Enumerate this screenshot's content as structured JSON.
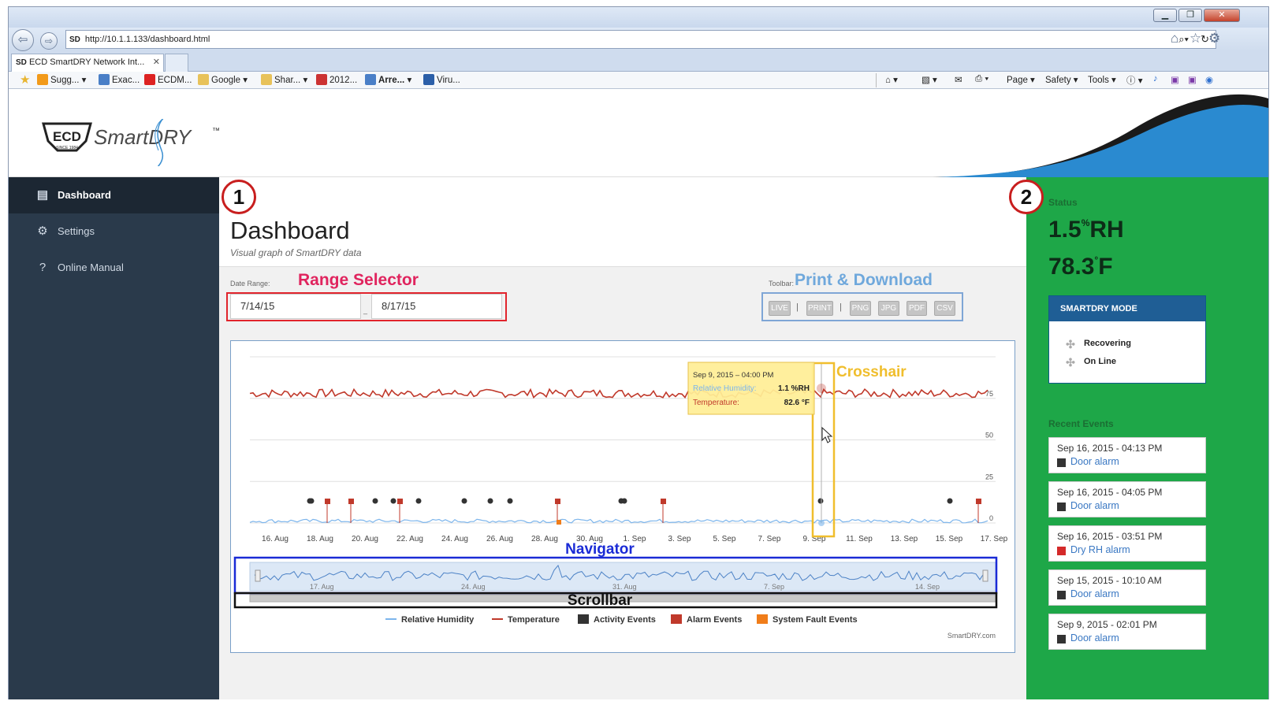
{
  "browser": {
    "window_buttons": [
      "▁",
      "❐",
      "✕"
    ],
    "url": "http://10.1.1.133/dashboard.html",
    "tab_title": "ECD SmartDRY Network Int...",
    "favorites": [
      "Sugg...",
      "Exac...",
      "ECDM...",
      "Google",
      "Shar...",
      "2012...",
      "Arre...",
      "Viru..."
    ],
    "toolbar_menus": [
      "Page",
      "Safety",
      "Tools"
    ]
  },
  "logo": {
    "brand_prefix": "ECD",
    "since": "SINCE 1984",
    "brand": "SmartDRY",
    "tm": "™"
  },
  "sidebar": {
    "items": [
      {
        "label": "Dashboard",
        "icon": "calendar-icon",
        "active": true
      },
      {
        "label": "Settings",
        "icon": "gear-icon",
        "active": false
      },
      {
        "label": "Online Manual",
        "icon": "help-circle-icon",
        "active": false
      }
    ]
  },
  "main": {
    "callout_number": "1",
    "title": "Dashboard",
    "subtitle": "Visual graph of SmartDRY data",
    "date_range_label": "Date Range:",
    "date_from": "7/14/15",
    "date_to": "8/17/15",
    "date_separator": "_",
    "range_selector_annotation": "Range Selector",
    "toolbar_label": "Toolbar:",
    "print_download_annotation": "Print & Download",
    "toolbar_buttons": [
      "LIVE",
      "PRINT",
      "PNG",
      "JPG",
      "PDF",
      "CSV"
    ],
    "toolbar_separator": "|"
  },
  "chart_data": {
    "type": "line",
    "title": "",
    "x_tick_labels": [
      "16. Aug",
      "18. Aug",
      "20. Aug",
      "22. Aug",
      "24. Aug",
      "26. Aug",
      "28. Aug",
      "30. Aug",
      "1. Sep",
      "3. Sep",
      "5. Sep",
      "7. Sep",
      "9. Sep",
      "11. Sep",
      "13. Sep",
      "15. Sep",
      "17. Sep"
    ],
    "y_ticks": [
      0,
      25,
      50,
      75
    ],
    "y_tick_labels": [
      "0",
      "25",
      "50",
      "75"
    ],
    "ylim": [
      0,
      100
    ],
    "grid": true,
    "series": [
      {
        "name": "Relative Humidity",
        "color": "#7cb5ec",
        "approx_level": 1.2
      },
      {
        "name": "Temperature",
        "color": "#c0392b",
        "approx_level": 78
      }
    ],
    "event_legend": [
      {
        "name": "Activity Events",
        "color": "#333333"
      },
      {
        "name": "Alarm Events",
        "color": "#c0392b"
      },
      {
        "name": "System Fault Events",
        "color": "#f07d1a"
      }
    ],
    "legend": [
      "Relative Humidity",
      "Temperature",
      "Activity Events",
      "Alarm Events",
      "System Fault Events"
    ],
    "legend_placement": "bottom",
    "navigator_tick_labels": [
      "17. Aug",
      "24. Aug",
      "31. Aug",
      "7. Sep",
      "14. Sep"
    ],
    "tooltip": {
      "header": "Sep 9, 2015 – 04:00 PM",
      "rh_label": "Relative Humidity:",
      "rh_value": "1.1 %RH",
      "temp_label": "Temperature:",
      "temp_value": "82.6 °F"
    },
    "credits": "SmartDRY.com",
    "annotations": {
      "crosshair": "Crosshair",
      "navigator": "Navigator",
      "scrollbar": "Scrollbar"
    }
  },
  "status": {
    "callout_number": "2",
    "label": "Status",
    "rh_value": "1.5",
    "rh_unit_sup": "%",
    "rh_unit": "RH",
    "temp_value": "78.3",
    "temp_unit_sup": "°",
    "temp_unit": "F",
    "mode_title": "SMARTDRY MODE",
    "modes": [
      "Recovering",
      "On Line"
    ],
    "recent_label": "Recent Events",
    "events": [
      {
        "time": "Sep 16, 2015 - 04:13 PM",
        "type": "Door alarm",
        "color": "#333333"
      },
      {
        "time": "Sep 16, 2015 - 04:05 PM",
        "type": "Door alarm",
        "color": "#333333"
      },
      {
        "time": "Sep 16, 2015 - 03:51 PM",
        "type": "Dry RH alarm",
        "color": "#d42a2a"
      },
      {
        "time": "Sep 15, 2015 - 10:10 AM",
        "type": "Door alarm",
        "color": "#333333"
      },
      {
        "time": "Sep 9, 2015 - 02:01 PM",
        "type": "Door alarm",
        "color": "#333333"
      }
    ]
  }
}
